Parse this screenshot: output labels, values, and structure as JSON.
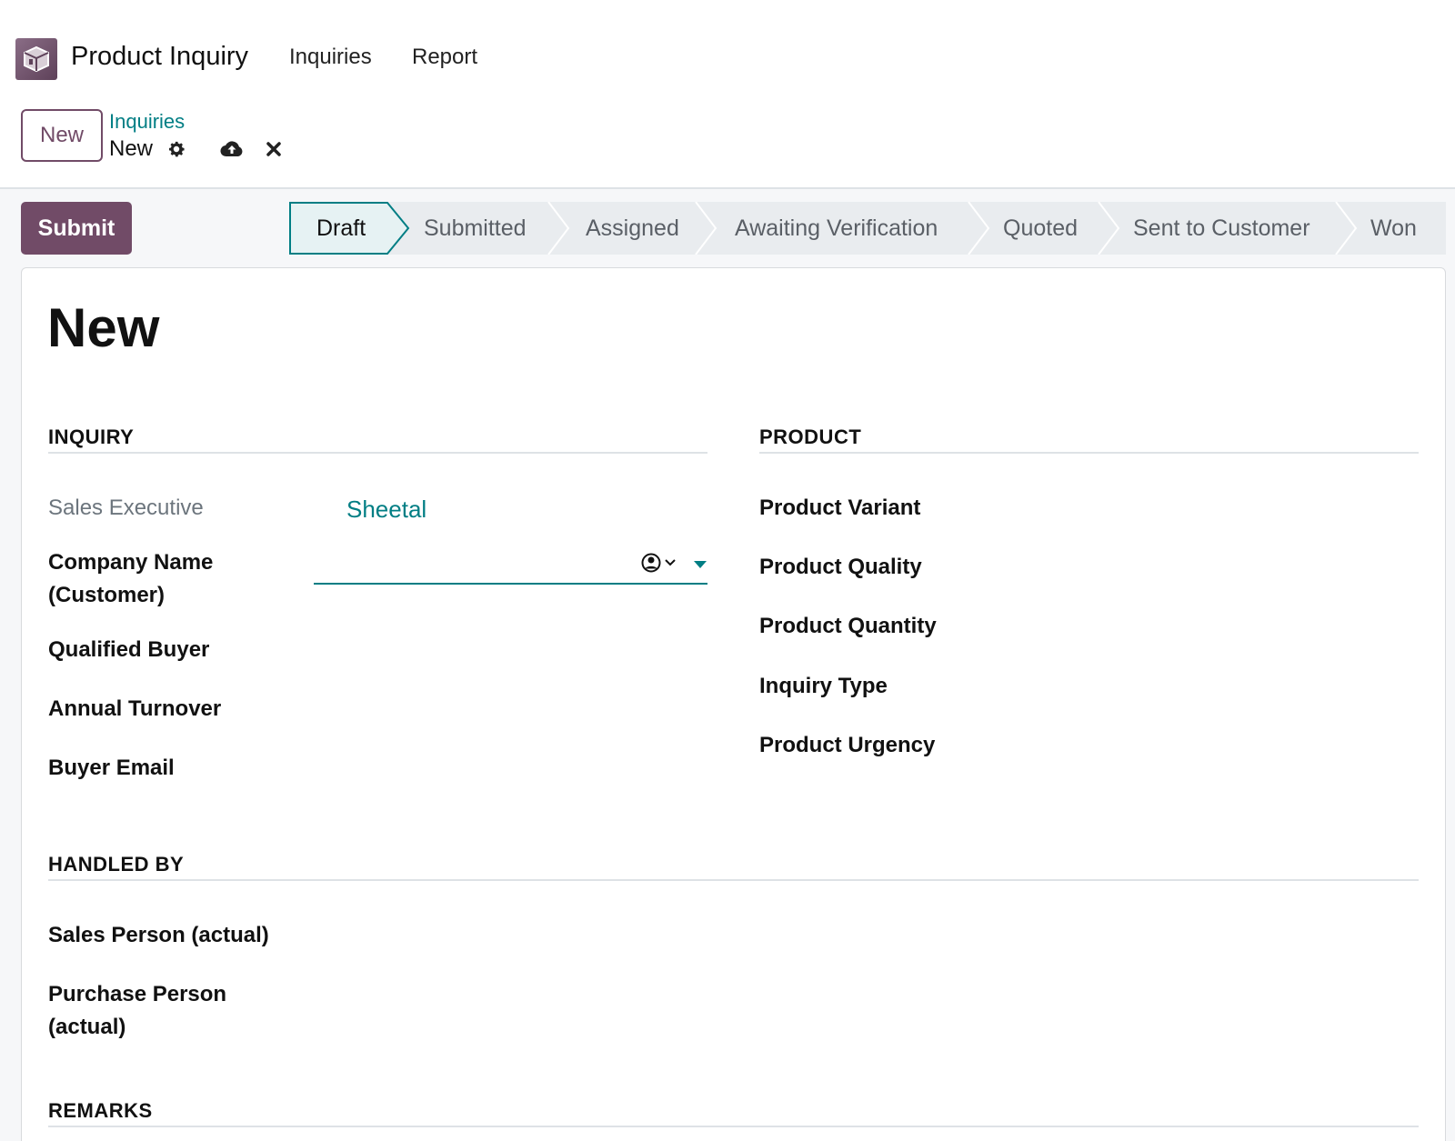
{
  "navbar": {
    "app_name": "Product Inquiry",
    "menu": [
      "Inquiries",
      "Report"
    ]
  },
  "control_panel": {
    "new_label": "New",
    "breadcrumb_parent": "Inquiries",
    "breadcrumb_current": "New"
  },
  "form": {
    "submit_label": "Submit",
    "stages": [
      "Draft",
      "Submitted",
      "Assigned",
      "Awaiting Verification",
      "Quoted",
      "Sent to Customer",
      "Won"
    ],
    "active_stage": "Draft",
    "record_title": "New",
    "sections": {
      "inquiry": "INQUIRY",
      "product": "PRODUCT",
      "handled_by": "HANDLED BY",
      "remarks": "REMARKS"
    },
    "inquiry_fields": {
      "sales_executive_label": "Sales Executive",
      "sales_executive_value": "Sheetal",
      "company_name_label": "Company Name (Customer)",
      "company_name_value": "",
      "qualified_buyer_label": "Qualified Buyer",
      "annual_turnover_label": "Annual Turnover",
      "buyer_email_label": "Buyer Email"
    },
    "product_fields": {
      "product_variant_label": "Product Variant",
      "product_quality_label": "Product Quality",
      "product_quantity_label": "Product Quantity",
      "inquiry_type_label": "Inquiry Type",
      "product_urgency_label": "Product Urgency"
    },
    "handled_by_fields": {
      "sales_person_label": "Sales Person (actual)",
      "purchase_person_label": "Purchase Person (actual)"
    }
  },
  "colors": {
    "brand": "#714b67",
    "link": "#017e84",
    "active_stage_bg": "#e6f2f3"
  },
  "icons": [
    "app-box-icon",
    "gear-icon",
    "cloud-upload-icon",
    "close-icon",
    "avatar-icon",
    "chevron-down-icon",
    "caret-down-icon"
  ]
}
